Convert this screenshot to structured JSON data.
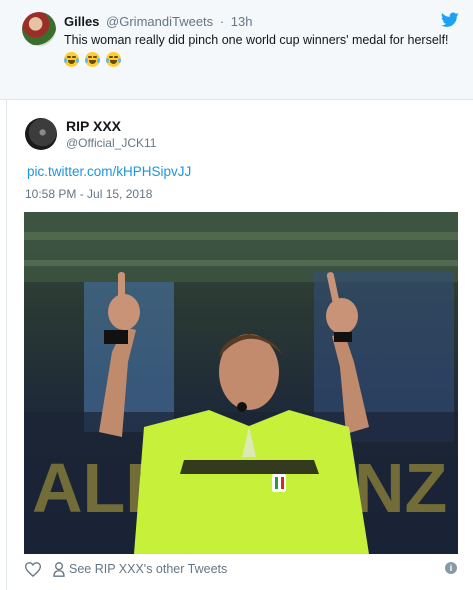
{
  "reply_tweet": {
    "author_name": "Gilles",
    "author_handle": "@GrimandiTweets",
    "separator": "·",
    "time_ago": "13h",
    "text": "This woman really did pinch one world cup winners' medal for herself!",
    "emojis": [
      "face-with-tears-of-joy",
      "face-with-tears-of-joy",
      "face-with-tears-of-joy"
    ],
    "brand_icon": "twitter-bird-icon"
  },
  "embedded_tweet": {
    "author_name": "RIP XXX",
    "author_handle": "@Official_JCK11",
    "link_text": "pic.twitter.com/kHPHSipvJJ",
    "timestamp": "10:58 PM - Jul 15, 2018",
    "actions": {
      "like_icon": "heart-icon",
      "profile_icon": "person-icon",
      "other_tweets_label": "See RIP XXX's other Tweets",
      "info_icon": "info-icon"
    }
  },
  "colors": {
    "link": "#1b95e0",
    "secondary_text": "#657786",
    "header_bg": "#f5f8fa",
    "twitter_blue": "#1da1f2",
    "jersey": "#c6f03a"
  }
}
